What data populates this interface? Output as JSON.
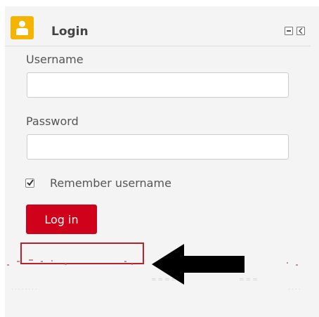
{
  "login_module": {
    "title": "Login",
    "icon": "user-icon",
    "controls": [
      "minimize-icon",
      "collapse-icon"
    ]
  },
  "form": {
    "username_label": "Username",
    "username_value": "",
    "password_label": "Password",
    "password_value": "",
    "remember_label": "Remember username",
    "remember_checked": true,
    "login_button": "Log in"
  },
  "colors": {
    "accent": "#d0021b",
    "icon_bg": "#f5b400",
    "highlight_box": "#b8202a"
  }
}
